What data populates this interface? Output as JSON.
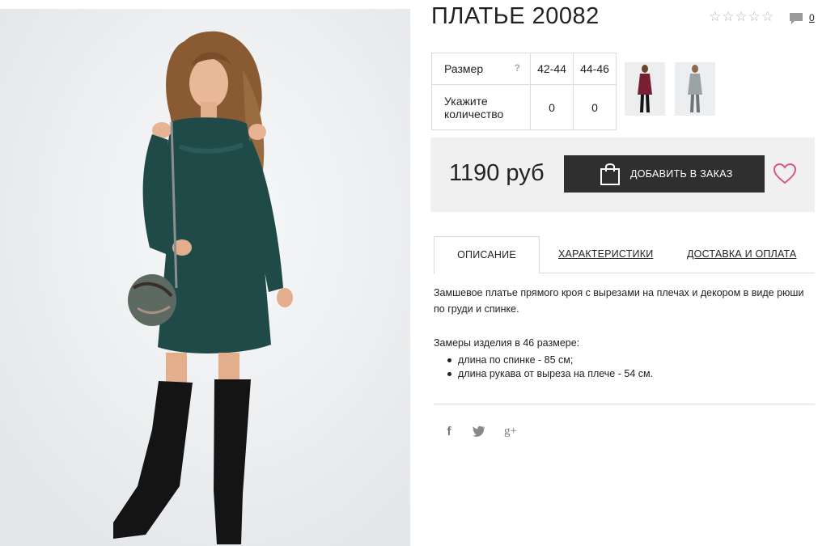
{
  "product": {
    "title": "ПЛАТЬЕ 20082",
    "rating_stars": 5,
    "rating_value": 0,
    "comments_count": "0",
    "image_alt": "model-in-dark-green-dress"
  },
  "size_table": {
    "size_label": "Размер",
    "help_glyph": "?",
    "sizes": [
      "42-44",
      "44-46"
    ],
    "qty_label": "Укажите количество",
    "quantities": [
      "0",
      "0"
    ]
  },
  "thumbnails": [
    {
      "name": "burgundy-dress-variant",
      "color": "#7a1e34"
    },
    {
      "name": "grey-dress-variant",
      "color": "#9aa3a5"
    }
  ],
  "purchase": {
    "price": "1190 руб",
    "add_button_label": "ДОБАВИТЬ В ЗАКАЗ",
    "accent_heart_color": "#d9557b",
    "button_color": "#2f2f2f"
  },
  "tabs": [
    {
      "label": "ОПИСАНИЕ",
      "active": true
    },
    {
      "label": "ХАРАКТЕРИСТИКИ",
      "active": false
    },
    {
      "label": "ДОСТАВКА И ОПЛАТА",
      "active": false
    }
  ],
  "description": {
    "text": "Замшевое платье прямого кроя с вырезами на плечах и декором в виде рюши по груди и спинке.",
    "measures_title": "Замеры изделия в 46 размере:",
    "measures": [
      "длина по спинке - 85 см;",
      "длина рукава от выреза на плече - 54 см."
    ]
  },
  "social": [
    {
      "icon": "facebook-icon",
      "glyph": "f"
    },
    {
      "icon": "twitter-icon",
      "glyph": "🐦"
    },
    {
      "icon": "google-plus-icon",
      "glyph": "g+"
    }
  ]
}
